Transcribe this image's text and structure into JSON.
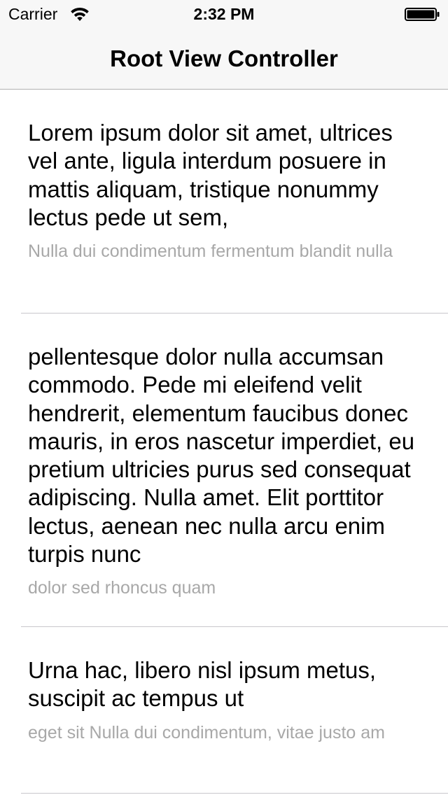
{
  "status_bar": {
    "carrier": "Carrier",
    "time": "2:32 PM",
    "wifi_icon": "wifi-icon",
    "battery_icon": "battery-icon"
  },
  "nav_bar": {
    "title": "Root View Controller"
  },
  "table": {
    "rows": [
      {
        "title": "Lorem ipsum dolor sit amet, ultrices vel ante, ligula interdum posuere in mattis aliquam, tristique nonummy lectus pede ut sem,",
        "subtitle": "Nulla dui condimentum fermentum blandit nulla"
      },
      {
        "title": "pellentesque dolor nulla accumsan commodo. Pede mi eleifend velit hendrerit, elementum faucibus donec mauris, in eros nascetur imperdiet, eu pretium ultricies purus sed consequat adipiscing. Nulla amet. Elit porttitor lectus, aenean nec nulla arcu enim turpis nunc",
        "subtitle": "dolor sed rhoncus quam"
      },
      {
        "title": "Urna hac, libero nisl ipsum metus, suscipit ac tempus ut",
        "subtitle": "eget sit Nulla dui condimentum, vitae justo am"
      }
    ]
  },
  "colors": {
    "nav_background": "#f7f7f7",
    "subtitle_text": "#a8a8a8",
    "separator": "#c8c7cc"
  }
}
